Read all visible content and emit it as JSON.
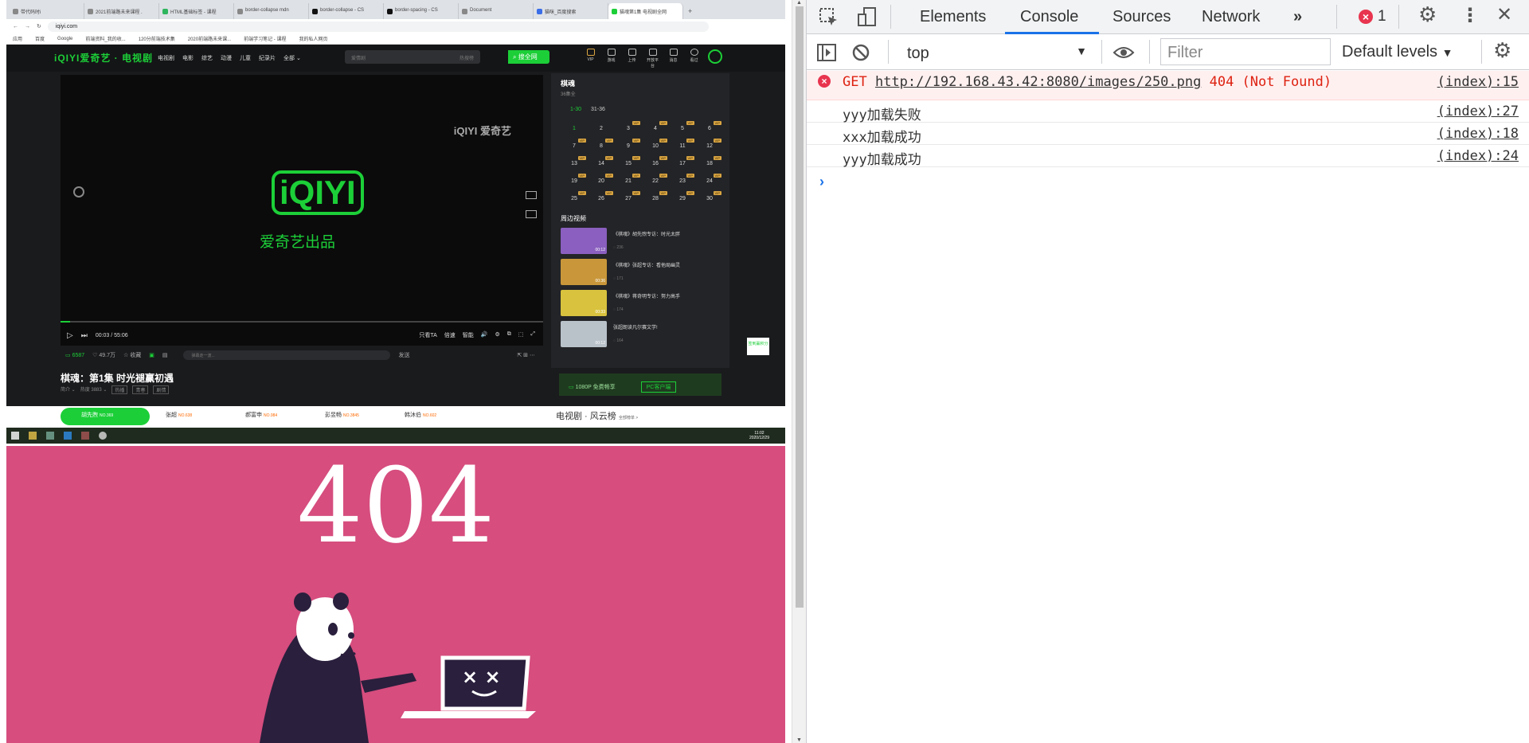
{
  "browser": {
    "tabs": [
      {
        "label": "带代码时i",
        "active": false
      },
      {
        "label": "2021前端路未来课程 .",
        "active": false
      },
      {
        "label": "HTML基础标签 - 课程",
        "active": false
      },
      {
        "label": "border-collapse mdn",
        "active": false
      },
      {
        "label": "border-collapse - CS",
        "active": false
      },
      {
        "label": "border-spacing - CS",
        "active": false
      },
      {
        "label": "Document",
        "active": false
      },
      {
        "label": "猫咪_百度搜索",
        "active": false
      },
      {
        "label": "猫魂第1集 电视剧全网",
        "active": true
      }
    ],
    "new_tab": "+",
    "url": "iqiyi.com",
    "bookmarks": [
      "应用",
      "百度",
      "Google",
      "前端资料_我的收...",
      "120分前端技术集",
      "2020前端路未来课...",
      "前端学习笔记 - 课程",
      "我的私人网页"
    ]
  },
  "iqiyi": {
    "logo": "iQIYI爱奇艺 · 电视剧",
    "nav": [
      "电视剧",
      "电影",
      "综艺",
      "动漫",
      "儿童",
      "纪录片",
      "全部 ⌄"
    ],
    "search_placeholder": "爱情剧",
    "search_hot": "热搜榜",
    "search_button": "搜全网",
    "user_icons": [
      "VIP",
      "游戏",
      "上传",
      "开放平台",
      "消息",
      "看过"
    ],
    "watermark": "iQIYI 爱奇艺",
    "player_logo": "iQIYI",
    "player_product": "爱奇艺出品",
    "time": "00:03 / 55:06",
    "controls": [
      "只看TA",
      "倍速",
      "智能",
      "🔊",
      "⚙",
      "⧉",
      "⬚",
      "⤢"
    ],
    "progress": 0.02,
    "danmu_count": "6587",
    "likes": "49.7万",
    "collect": "收藏",
    "danmu_placeholder": "弹幕走一波...",
    "send": "发送",
    "episode_title": "棋魂：第1集 时光褪赢初遇",
    "meta": [
      "简介 ⌄",
      "热度 3883 ⌄"
    ],
    "tags": [
      "热播",
      "青春",
      "剧情"
    ],
    "side_title": "棋魂",
    "side_sub": "36集全",
    "episode_tabs": [
      "1-30",
      "31-36"
    ],
    "episodes": [
      "1",
      "2",
      "3",
      "4",
      "5",
      "6",
      "7",
      "8",
      "9",
      "10",
      "11",
      "12",
      "13",
      "14",
      "15",
      "16",
      "17",
      "18",
      "19",
      "20",
      "21",
      "22",
      "23",
      "24",
      "25",
      "26",
      "27",
      "28",
      "29",
      "30"
    ],
    "vip_label": "VIP",
    "related_title": "周边视频",
    "related": [
      {
        "title": "《棋魂》胡先煦专访：时光太胖",
        "views": "236",
        "dur": "00:12"
      },
      {
        "title": "《棋魂》张超专访：看他局幽灵",
        "views": "171",
        "dur": "00:36"
      },
      {
        "title": "《棋魂》蒋奇明专访：努力高手",
        "views": "174",
        "dur": "00:33"
      },
      {
        "title": "张超朗读凡尔赛文学!",
        "views": "164",
        "dur": "00:12"
      }
    ],
    "promo_text": "1080P 免费畅享",
    "promo_button": "PC客户端",
    "gift": "签到赢积分",
    "stars": [
      {
        "name": "胡先煦",
        "rank": "NO.369"
      },
      {
        "name": "张超",
        "rank": "NO.638"
      },
      {
        "name": "郝富申",
        "rank": "NO.984"
      },
      {
        "name": "彭昱畅",
        "rank": "NO.3845"
      },
      {
        "name": "韩沐伯",
        "rank": "NO.602"
      }
    ],
    "rank_title": "电视剧 · 风云榜",
    "rank_more": "全部榜单 >",
    "clock_time": "11:02",
    "clock_date": "2020/12/29"
  },
  "error_page": {
    "code": "404"
  },
  "devtools": {
    "tabs": [
      "Elements",
      "Console",
      "Sources",
      "Network"
    ],
    "active_tab": "Console",
    "more": "»",
    "error_count": "1",
    "context": "top",
    "filter_placeholder": "Filter",
    "levels": "Default levels",
    "logs": [
      {
        "level": "error",
        "prefix": "GET ",
        "url": "http://192.168.43.42:8080/images/250.png",
        "status": " 404 (Not Found)",
        "source": "(index):15"
      },
      {
        "level": "info",
        "text": "yyy加载失败",
        "source": "(index):27"
      },
      {
        "level": "info",
        "text": "xxx加载成功",
        "source": "(index):18"
      },
      {
        "level": "info",
        "text": "yyy加载成功",
        "source": "(index):24"
      }
    ],
    "prompt": "›"
  },
  "colors": {
    "iqiyi_green": "#1ccf38",
    "error_bg": "#d64d7e",
    "devtools_accent": "#1a73e8",
    "error_red": "#e8344e"
  }
}
